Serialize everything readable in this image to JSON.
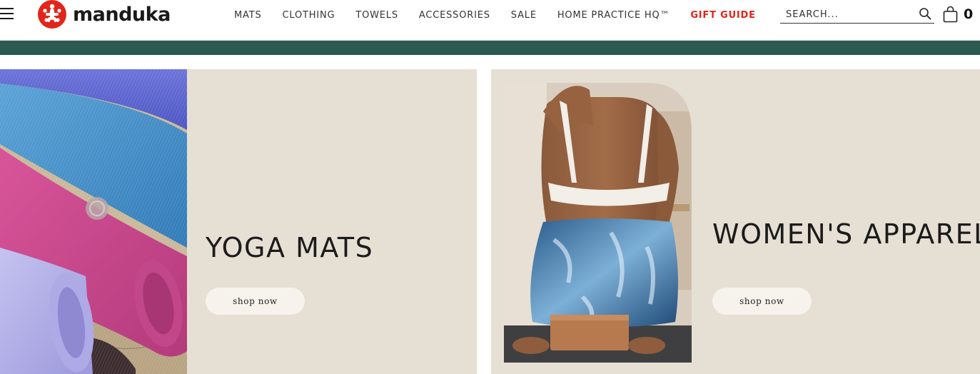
{
  "brand": {
    "name": "manduka",
    "accent_color": "#e1251b",
    "promo_bar_color": "#2c5a52"
  },
  "header": {
    "nav": [
      {
        "label": "MATS"
      },
      {
        "label": "CLOTHING"
      },
      {
        "label": "TOWELS"
      },
      {
        "label": "ACCESSORIES"
      },
      {
        "label": "SALE"
      },
      {
        "label": "HOME PRACTICE HQ™"
      },
      {
        "label": "GIFT GUIDE",
        "highlight": true
      }
    ],
    "search": {
      "placeholder": "SEARCH...",
      "value": "",
      "icon": "search-icon"
    },
    "cart": {
      "icon": "bag-icon",
      "count": "0"
    },
    "menu_icon": "hamburger-icon"
  },
  "promos": [
    {
      "title": "YOGA MATS",
      "cta": "shop now",
      "image": "rolled yoga mats in blue, pink and lavender"
    },
    {
      "title": "WOMEN'S APPAREL",
      "cta": "shop now",
      "image": "woman in sports bra and patterned leggings sitting on a cork block"
    }
  ]
}
